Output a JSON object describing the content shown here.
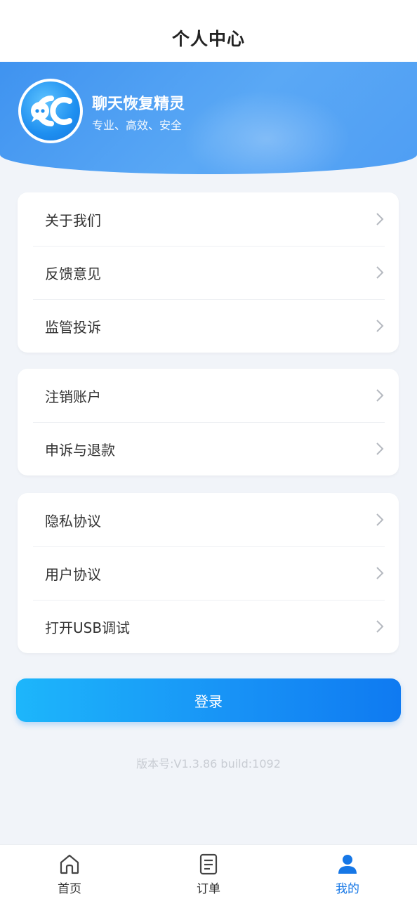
{
  "page_title": "个人中心",
  "profile": {
    "app_name": "聊天恢复精灵",
    "slogan": "专业、高效、安全",
    "logo_icon": "chat-bubble-cc-logo"
  },
  "menu_groups": [
    {
      "items": [
        {
          "label": "关于我们"
        },
        {
          "label": "反馈意见"
        },
        {
          "label": "监管投诉"
        }
      ]
    },
    {
      "items": [
        {
          "label": "注销账户"
        },
        {
          "label": "申诉与退款"
        }
      ]
    },
    {
      "items": [
        {
          "label": "隐私协议"
        },
        {
          "label": "用户协议"
        },
        {
          "label": "打开USB调试"
        }
      ]
    }
  ],
  "login_button": "登录",
  "version_text": "版本号:V1.3.86 build:1092",
  "tabbar": {
    "items": [
      {
        "label": "首页",
        "icon": "home-icon"
      },
      {
        "label": "订单",
        "icon": "document-icon"
      },
      {
        "label": "我的",
        "icon": "person-icon",
        "active": true
      }
    ]
  },
  "colors": {
    "accent": "#1677e6",
    "header_blue": "#4f9ef4",
    "background": "#f1f4f9"
  }
}
